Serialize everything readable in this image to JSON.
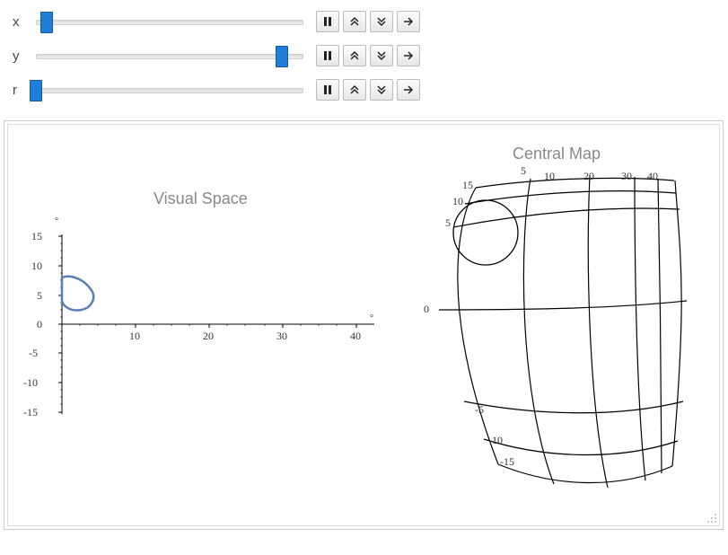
{
  "sliders": {
    "x": {
      "label": "x",
      "position_pct": 4
    },
    "y": {
      "label": "y",
      "position_pct": 92
    },
    "r": {
      "label": "r",
      "position_pct": 0
    }
  },
  "controls": {
    "pause_label": "pause",
    "faster_label": "faster",
    "slower_label": "slower",
    "play_label": "play"
  },
  "chart_data": [
    {
      "type": "scatter",
      "title": "Visual Space",
      "xlabel": "°",
      "ylabel": "°",
      "xlim": [
        0,
        42
      ],
      "ylim": [
        -15,
        15
      ],
      "xticks": [
        0,
        10,
        20,
        30,
        40
      ],
      "yticks": [
        -15,
        -10,
        -5,
        0,
        5,
        10,
        15
      ],
      "series": [
        {
          "name": "stimulus",
          "shape": "closed-curve",
          "center": [
            2.5,
            5
          ],
          "approx_radius": 3.2
        }
      ]
    },
    {
      "type": "line",
      "title": "Central Map",
      "grid": true,
      "elevation_lines": [
        -15,
        -10,
        -5,
        0,
        5,
        10,
        15
      ],
      "azimuth_lines": [
        5,
        10,
        20,
        30,
        40
      ],
      "elevation_labels_visible": [
        -15,
        -10,
        -5,
        0,
        5,
        10,
        15
      ],
      "azimuth_labels_visible": [
        5,
        10,
        20,
        30,
        40
      ],
      "overlay": {
        "name": "mapped-stimulus",
        "shape": "circle",
        "grid_center_approx": {
          "azimuth": 5,
          "elevation": 8
        },
        "pixel_radius_approx": 34
      }
    }
  ],
  "left_plot": {
    "title": "Visual Space",
    "deg_symbol": "°",
    "yticks": {
      "n15": "-15",
      "n10": "-10",
      "n5": "-5",
      "p0": "0",
      "p5": "5",
      "p10": "10",
      "p15": "15"
    },
    "xticks": {
      "p10": "10",
      "p20": "20",
      "p30": "30",
      "p40": "40"
    }
  },
  "right_plot": {
    "title": "Central Map",
    "az": {
      "a5": "5",
      "a10": "10",
      "a20": "20",
      "a30": "30",
      "a40": "40"
    },
    "el": {
      "e15": "15",
      "e10": "10",
      "e5": "5",
      "e0": "0",
      "en5": "-5",
      "en10": "-10",
      "en15": "-15"
    }
  }
}
